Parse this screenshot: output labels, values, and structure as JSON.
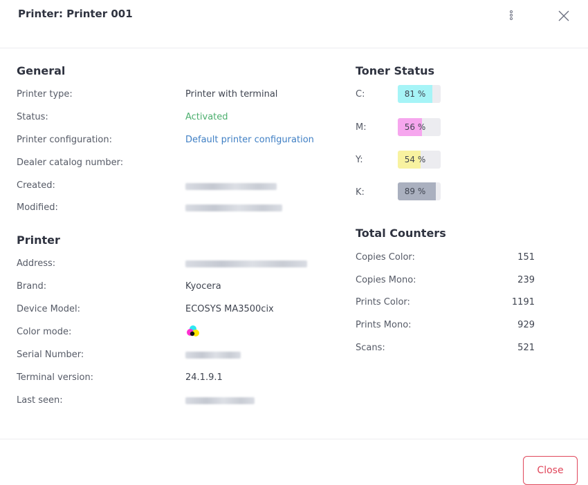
{
  "dialog": {
    "title": "Printer: Printer 001",
    "close_label": "Close"
  },
  "general": {
    "title": "General",
    "rows": [
      {
        "label": "Printer type:",
        "value": "Printer with terminal"
      },
      {
        "label": "Status:",
        "value": "Activated"
      },
      {
        "label": "Printer configuration:",
        "value": "Default printer configuration"
      },
      {
        "label": "Dealer catalog number:",
        "value": ""
      },
      {
        "label": "Created:",
        "value": ""
      },
      {
        "label": "Modified:",
        "value": ""
      }
    ]
  },
  "printer": {
    "title": "Printer",
    "rows": [
      {
        "label": "Address:",
        "value": ""
      },
      {
        "label": "Brand:",
        "value": "Kyocera"
      },
      {
        "label": "Device Model:",
        "value": "ECOSYS MA3500cix"
      },
      {
        "label": "Color mode:",
        "value": ""
      },
      {
        "label": "Serial Number:",
        "value": ""
      },
      {
        "label": "Terminal version:",
        "value": "24.1.9.1"
      },
      {
        "label": "Last seen:",
        "value": ""
      }
    ]
  },
  "toner": {
    "title": "Toner Status",
    "items": [
      {
        "label": "C:",
        "percent": 81,
        "text": "81 %",
        "color": "#a6f4f7"
      },
      {
        "label": "M:",
        "percent": 56,
        "text": "56 %",
        "color": "#f6a6ee"
      },
      {
        "label": "Y:",
        "percent": 54,
        "text": "54 %",
        "color": "#f8f2a0"
      },
      {
        "label": "K:",
        "percent": 89,
        "text": "89 %",
        "color": "#aab0bf"
      }
    ]
  },
  "counters": {
    "title": "Total Counters",
    "items": [
      {
        "label": "Copies Color:",
        "value": "151"
      },
      {
        "label": "Copies Mono:",
        "value": "239"
      },
      {
        "label": "Prints Color:",
        "value": "1191"
      },
      {
        "label": "Prints Mono:",
        "value": "929"
      },
      {
        "label": "Scans:",
        "value": "521"
      }
    ]
  },
  "icons": {
    "menu": "kebab-menu-icon",
    "close": "close-icon",
    "color_mode": "cmyk-dots-icon"
  },
  "colors": {
    "accent_green": "#4caf6e",
    "link": "#3f7fc4",
    "danger": "#e0465a"
  }
}
